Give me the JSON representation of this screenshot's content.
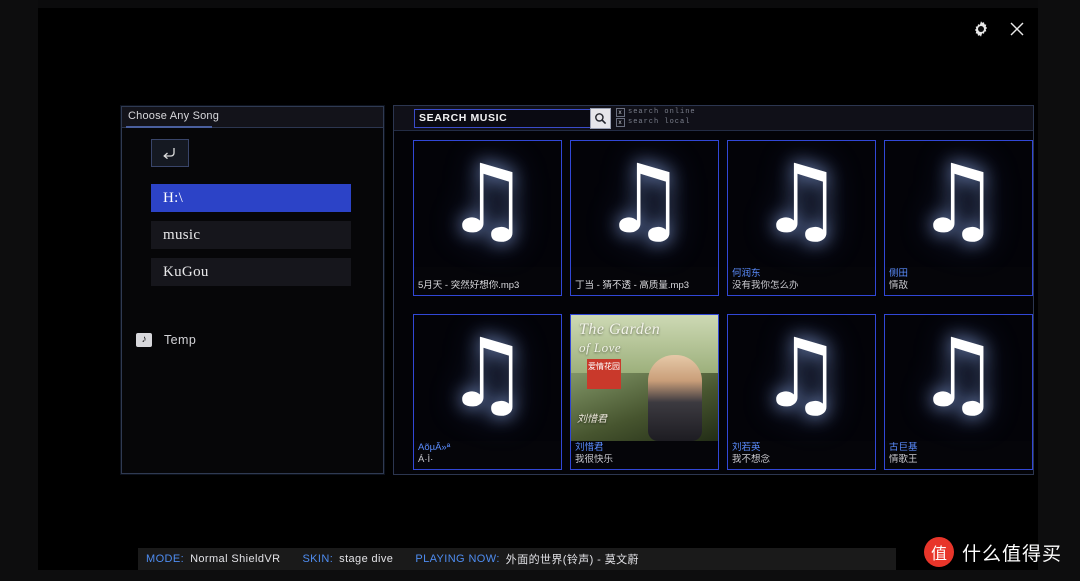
{
  "window": {
    "settings_icon": "gear-icon",
    "close_icon": "close-icon"
  },
  "left_panel": {
    "title": "Choose Any Song",
    "back_icon": "back-arrow-icon",
    "paths": [
      {
        "label": "H:\\",
        "selected": true
      },
      {
        "label": "music",
        "selected": false
      },
      {
        "label": "KuGou",
        "selected": false
      }
    ],
    "folders": [
      {
        "icon": "music-folder-icon",
        "label": "Temp"
      }
    ]
  },
  "right_panel": {
    "search": {
      "value": "SEARCH MUSIC",
      "placeholder": "SEARCH MUSIC",
      "button_icon": "search-icon",
      "modes": [
        {
          "box": "x",
          "label": "search online"
        },
        {
          "box": "x",
          "label": "search local"
        }
      ]
    },
    "cards": [
      {
        "art": "music-note",
        "line1": "5月天 - 突然好想你.mp3",
        "line2": "",
        "accent": false
      },
      {
        "art": "music-note",
        "line1": "丁当 - 猜不透 - 高质量.mp3",
        "line2": "",
        "accent": false
      },
      {
        "art": "music-note",
        "line1": "何润东",
        "line2": "没有我你怎么办",
        "accent": true
      },
      {
        "art": "music-note",
        "line1": "侧田",
        "line2": "情敌",
        "accent": true
      },
      {
        "art": "music-note",
        "line1": "AõµÂ»ª",
        "line2": "Á·Ì·",
        "accent": true
      },
      {
        "art": "photo",
        "line1": "刘惜君",
        "line2": "我很快乐",
        "accent": true,
        "photo": {
          "script": "The Garden",
          "script2": "of Love",
          "badge": "爱情花园",
          "caption": "刘惜君"
        }
      },
      {
        "art": "music-note",
        "line1": "刘若英",
        "line2": "我不想念",
        "accent": true
      },
      {
        "art": "music-note",
        "line1": "古巨基",
        "line2": "情歌王",
        "accent": true
      }
    ]
  },
  "status_bar": {
    "items": [
      {
        "key": "MODE:",
        "value": "Normal ShieldVR"
      },
      {
        "key": "SKIN:",
        "value": "stage dive"
      },
      {
        "key": "PLAYING NOW:",
        "value": "外面的世界(铃声) - 莫文蔚"
      }
    ]
  },
  "watermark": {
    "badge": "值",
    "text": "什么值得买"
  }
}
